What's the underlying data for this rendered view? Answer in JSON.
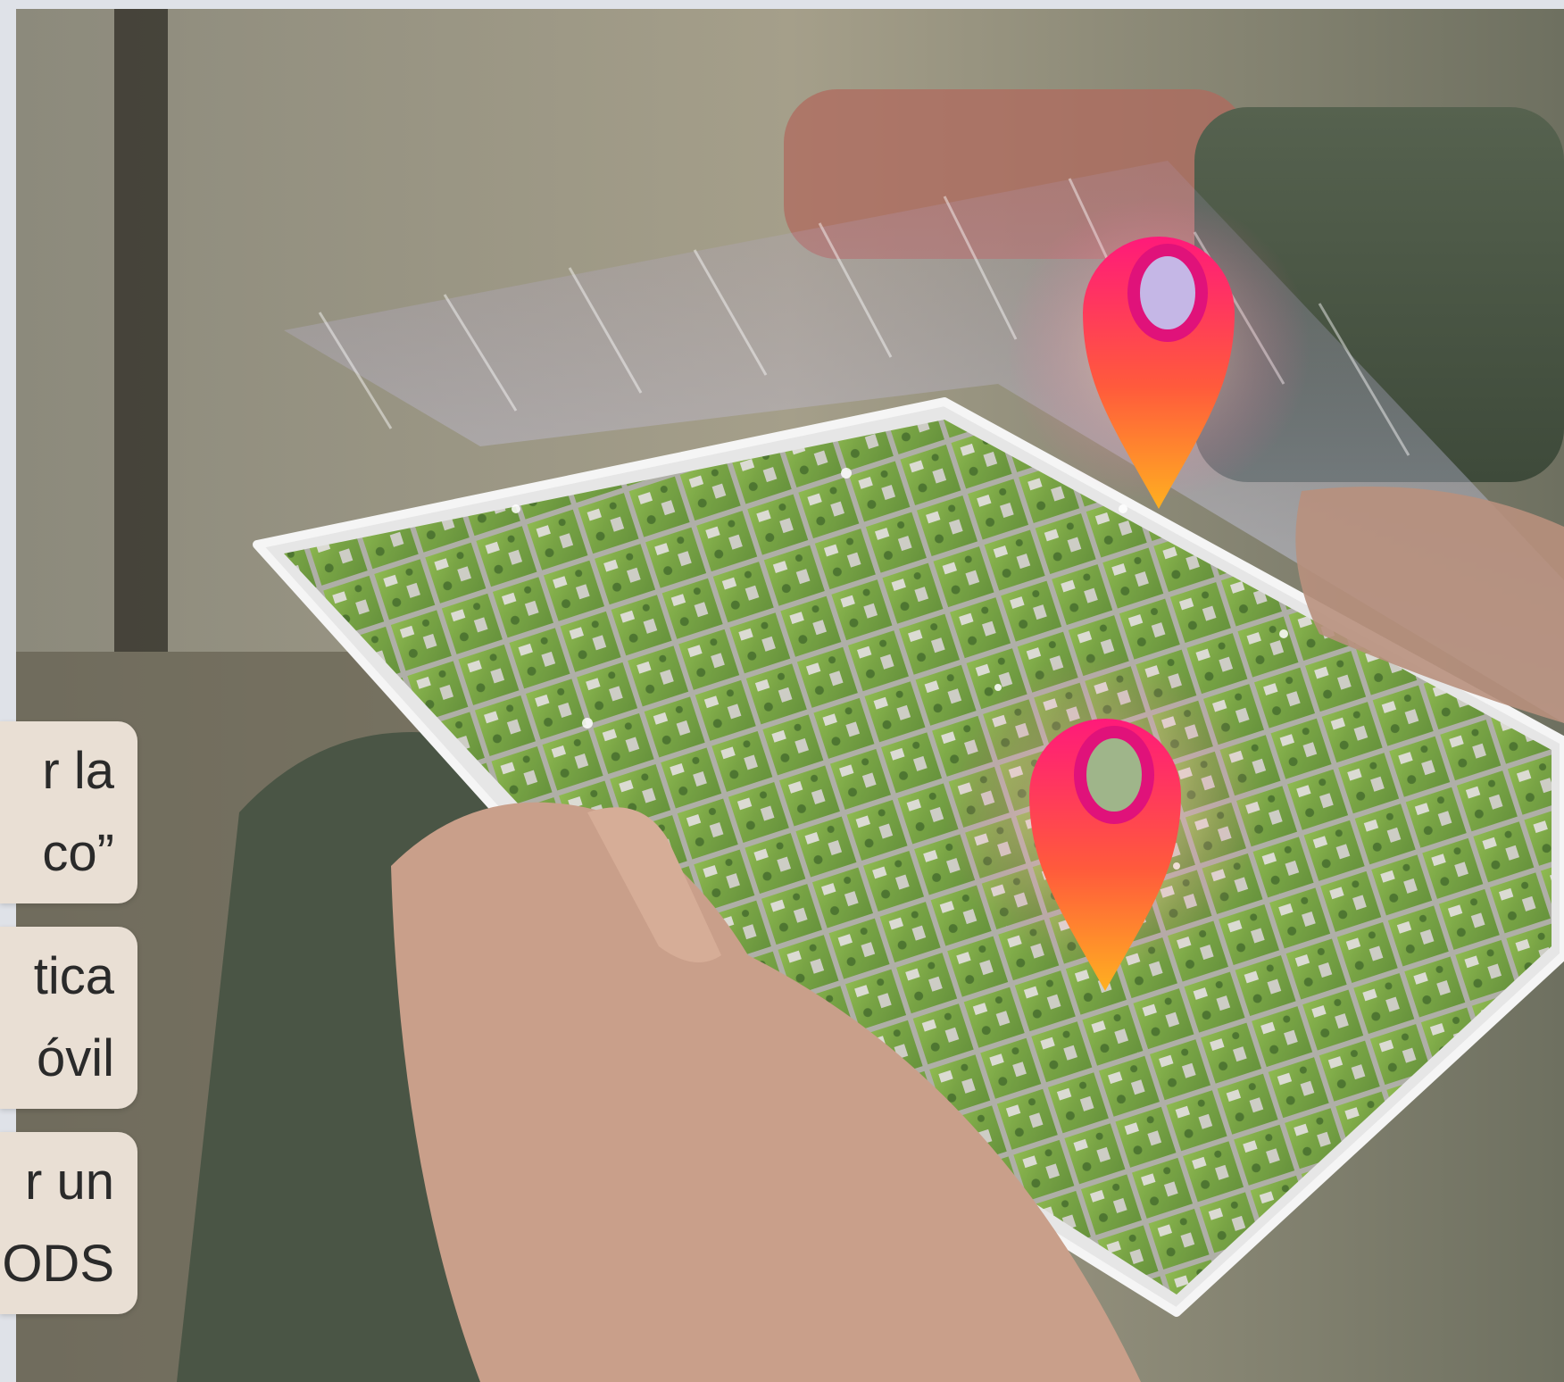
{
  "captions": [
    {
      "line1": "r la",
      "line2": "co”"
    },
    {
      "line1": "tica",
      "line2": "óvil"
    },
    {
      "line1": "r un",
      "line2": "ODS"
    }
  ],
  "colors": {
    "card_background": "#e9dfd4",
    "pin_top": "#ff1a7a",
    "pin_bottom": "#ffb020",
    "map_green": "#7fae3a"
  },
  "icons": [
    "location-pin-icon",
    "location-pin-icon"
  ]
}
